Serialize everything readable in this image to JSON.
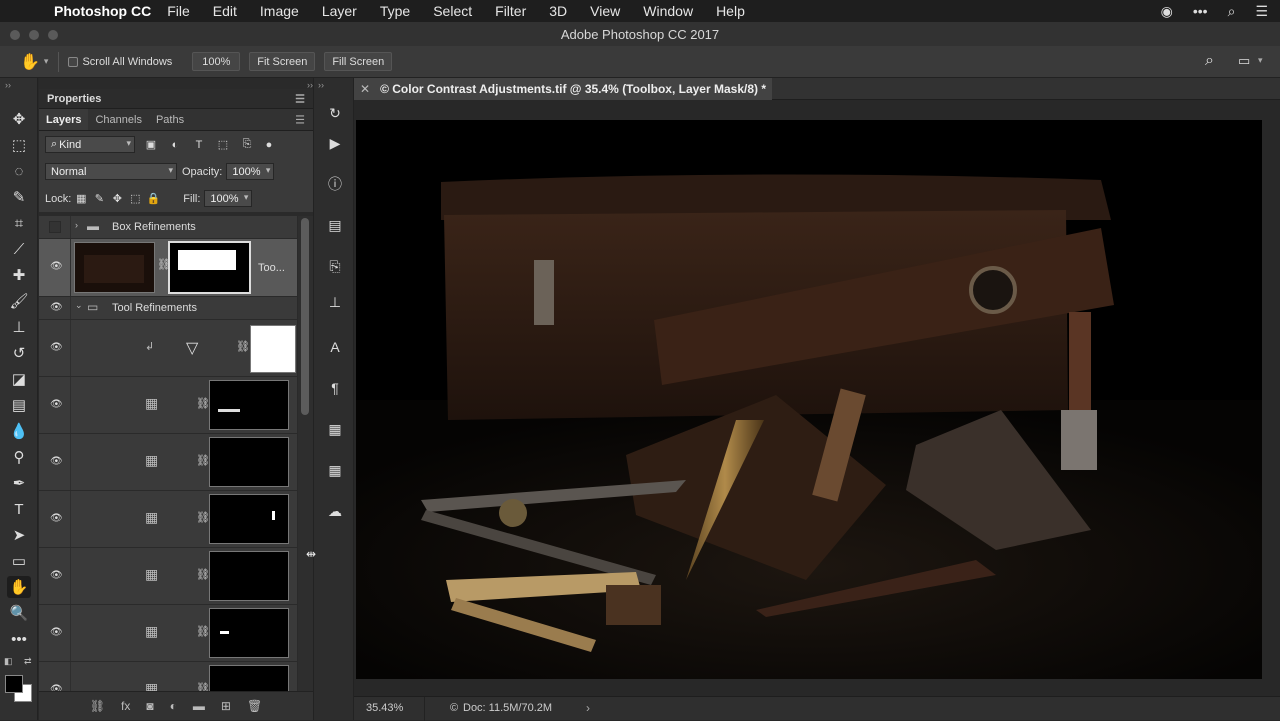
{
  "menubar": {
    "app": "Photoshop CC",
    "items": [
      "File",
      "Edit",
      "Image",
      "Layer",
      "Type",
      "Select",
      "Filter",
      "3D",
      "View",
      "Window",
      "Help"
    ]
  },
  "window": {
    "title": "Adobe Photoshop CC 2017"
  },
  "options": {
    "scroll_all_windows": "Scroll All Windows",
    "zoom": "100%",
    "fit_screen": "Fit Screen",
    "fill_screen": "Fill Screen"
  },
  "properties_panel": {
    "title": "Properties"
  },
  "layers_panel": {
    "tabs": [
      "Layers",
      "Channels",
      "Paths"
    ],
    "filter_kind": "Kind",
    "blend_mode": "Normal",
    "opacity_label": "Opacity:",
    "opacity": "100%",
    "lock_label": "Lock:",
    "fill_label": "Fill:",
    "fill": "100%",
    "groups": {
      "box": "Box Refinements",
      "tool": "Tool Refinements"
    },
    "selected_layer_name": "Too..."
  },
  "document": {
    "tab_title": "© Color Contrast Adjustments.tif @ 35.4% (Toolbox, Layer Mask/8) *"
  },
  "status": {
    "zoom": "35.43%",
    "doc": "Doc: 11.5M/70.2M"
  },
  "colors": {
    "canvas_bg": "#000000",
    "panel_bg": "#3a3a3a",
    "selected_layer": "#595959"
  }
}
